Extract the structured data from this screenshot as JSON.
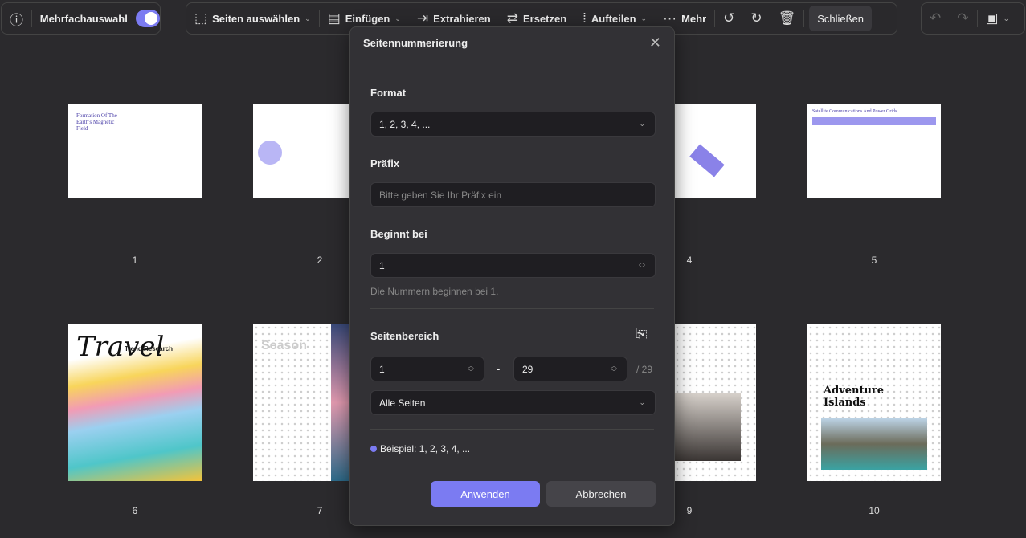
{
  "toolbar": {
    "multi_select": "Mehrfachauswahl",
    "select_pages": "Seiten auswählen",
    "insert": "Einfügen",
    "extract": "Extrahieren",
    "replace": "Ersetzen",
    "split": "Aufteilen",
    "more": "Mehr",
    "close": "Schließen"
  },
  "pages": [
    {
      "num": "1",
      "title": "Formation Of The Earth's Magnetic Field"
    },
    {
      "num": "2",
      "title": ""
    },
    {
      "num": "4",
      "title": ""
    },
    {
      "num": "5",
      "title": "Satellite Communications And Power Grids"
    },
    {
      "num": "6",
      "title": "Travel",
      "subtitle": "Trend Research"
    },
    {
      "num": "7",
      "title": "Season"
    },
    {
      "num": "9",
      "title": ""
    },
    {
      "num": "10",
      "title": "Adventure Islands"
    }
  ],
  "dialog": {
    "title": "Seitennummerierung",
    "format_label": "Format",
    "format_value": "1, 2, 3, 4, ...",
    "prefix_label": "Präfix",
    "prefix_placeholder": "Bitte geben Sie Ihr Präfix ein",
    "start_label": "Beginnt bei",
    "start_value": "1",
    "start_hint": "Die Nummern beginnen bei 1.",
    "range_label": "Seitenbereich",
    "range_from": "1",
    "range_dash": "-",
    "range_to": "29",
    "range_total": "/ 29",
    "range_select": "Alle Seiten",
    "example": "Beispiel: 1, 2, 3, 4, ...",
    "apply": "Anwenden",
    "cancel": "Abbrechen"
  },
  "colors": {
    "accent": "#7b7bf2"
  }
}
